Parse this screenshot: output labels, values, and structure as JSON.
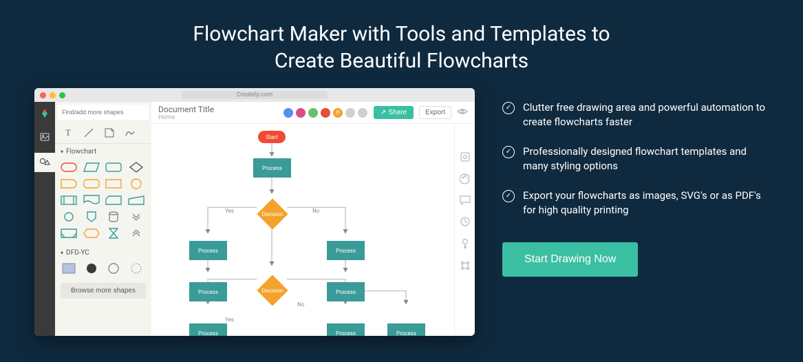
{
  "hero": {
    "title_l1": "Flowchart Maker with Tools and Templates to",
    "title_l2": "Create Beautiful Flowcharts"
  },
  "window": {
    "url": "Creately.com",
    "traffic_colors": [
      "#ff5f56",
      "#ffbd2e",
      "#27c93f"
    ]
  },
  "shapes_panel": {
    "search_placeholder": "Find/add more shapes",
    "group1": "Flowchart",
    "group2": "DFD-YC",
    "browse": "Browse more shapes"
  },
  "header": {
    "doc_title": "Document Title",
    "doc_sub": "Home",
    "avatar_colors": [
      "#5b8def",
      "#d94c8a",
      "#6abf6a",
      "#e74c3c",
      "#f4a22a",
      "#bdbdbd",
      "#bdbdbd"
    ],
    "avatar_letter": "H",
    "share": "Share",
    "export": "Export"
  },
  "flow": {
    "start": "Start",
    "process": "Process",
    "decision": "Decision",
    "yes": "Yes",
    "no": "No"
  },
  "features": [
    "Clutter free drawing area and powerful automation to create flowcharts faster",
    "Professionally designed flowchart templates and many styling options",
    "Export your flowcharts as images, SVG's or as PDF's for high quality printing"
  ],
  "cta": "Start Drawing Now"
}
